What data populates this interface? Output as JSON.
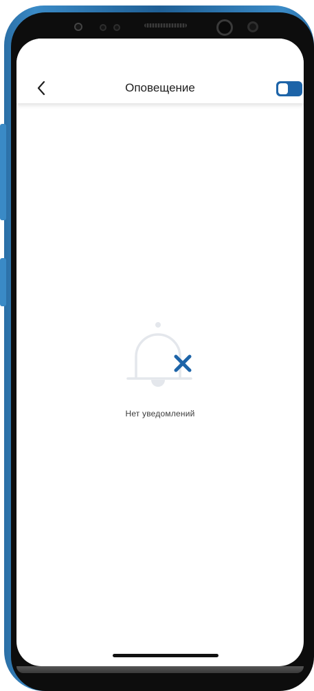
{
  "header": {
    "title": "Оповещение",
    "back_icon": "chevron-left-icon",
    "toggle": {
      "state": "on",
      "color": "#1d64a8"
    }
  },
  "empty_state": {
    "icon": "bell-off-icon",
    "icon_accent_color": "#1d64a8",
    "message": "Нет уведомлений"
  },
  "device": {
    "frame_color": "#2b6fa6"
  }
}
